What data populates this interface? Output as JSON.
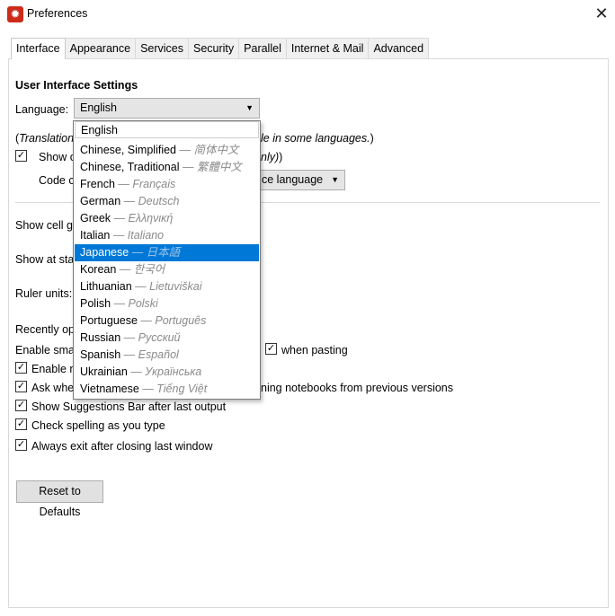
{
  "window": {
    "title": "Preferences",
    "icon": "app-gear-icon"
  },
  "tabs": [
    "Interface",
    "Appearance",
    "Services",
    "Security",
    "Parallel",
    "Internet & Mail",
    "Advanced"
  ],
  "section_title": "User Interface Settings",
  "language": {
    "label": "Language:",
    "value": "English"
  },
  "translation_note": {
    "left_open": "(",
    "left_text": "Translation",
    "right_text": "le in some languages.",
    "right_close": ")"
  },
  "show_row": {
    "left": "Show c",
    "right": "nly)",
    "right_close": ""
  },
  "code_row": {
    "left": "Code c",
    "combo_value": "ce language"
  },
  "show_cell": "Show cell gr",
  "show_start": "Show at star",
  "ruler_units": "Ruler units:",
  "recently": "Recently op",
  "enable_smart": "Enable smar",
  "when_pasting": "when pasting",
  "enable_n": "Enable n",
  "ask_when": "Ask whe",
  "ask_right": "ning notebooks from previous versions",
  "suggestions": "Show Suggestions Bar after last output",
  "spelling": "Check spelling as you type",
  "always_exit": "Always exit after closing last window",
  "reset_button": "Reset to Defaults",
  "dropdown": {
    "items": [
      {
        "name": "English",
        "native": ""
      },
      {
        "name": "Chinese, Simplified",
        "native": "— 简体中文"
      },
      {
        "name": "Chinese, Traditional",
        "native": "— 繁體中文"
      },
      {
        "name": "French",
        "native": "— Français"
      },
      {
        "name": "German",
        "native": "— Deutsch"
      },
      {
        "name": "Greek",
        "native": "— Ελληνική"
      },
      {
        "name": "Italian",
        "native": "— Italiano"
      },
      {
        "name": "Japanese",
        "native": "— 日本語"
      },
      {
        "name": "Korean",
        "native": "— 한국어"
      },
      {
        "name": "Lithuanian",
        "native": "— Lietuviškai"
      },
      {
        "name": "Polish",
        "native": "— Polski"
      },
      {
        "name": "Portuguese",
        "native": "— Português"
      },
      {
        "name": "Russian",
        "native": "— Русский"
      },
      {
        "name": "Spanish",
        "native": "— Español"
      },
      {
        "name": "Ukrainian",
        "native": "— Українська"
      },
      {
        "name": "Vietnamese",
        "native": "— Tiếng Việt"
      }
    ],
    "highlighted": "Japanese"
  },
  "colors": {
    "highlight": "#0078d7",
    "app_icon": "#cc2b1a"
  }
}
